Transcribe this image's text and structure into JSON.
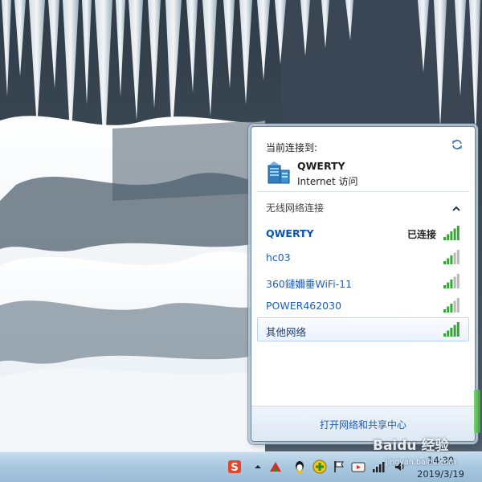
{
  "flyout": {
    "current_label": "当前连接到:",
    "connection": {
      "name": "QWERTY",
      "access": "Internet 访问"
    },
    "section_title": "无线网络连接",
    "networks": [
      {
        "name": "QWERTY",
        "status": "已连接",
        "signal_bars": 5
      },
      {
        "name": "hc03",
        "status": "",
        "signal_bars": 3
      },
      {
        "name": "360鏈嬭垂WiFi-11",
        "status": "",
        "signal_bars": 3
      },
      {
        "name": "POWER462030",
        "status": "",
        "signal_bars": 3
      },
      {
        "name": "其他网络",
        "status": "",
        "signal_bars": 5
      }
    ],
    "footer_link": "打开网络和共享中心"
  },
  "taskbar": {
    "clock_time": "14:30",
    "clock_date": "2019/3/19",
    "tray_icons": [
      "sogou-input-icon",
      "show-hidden-icons-arrow",
      "antivirus-icon",
      "qq-icon",
      "plus-app-icon",
      "action-center-flag-icon",
      "video-app-icon",
      "network-signal-icon",
      "volume-icon"
    ]
  },
  "watermark": {
    "main": "Baidu 经验",
    "sub": "jingyan.baidu.com"
  },
  "colors": {
    "link": "#1f5fb4",
    "signal_on": "#3aa33a",
    "signal_off": "#b9b9b9",
    "taskbar": "#aac9e0"
  }
}
